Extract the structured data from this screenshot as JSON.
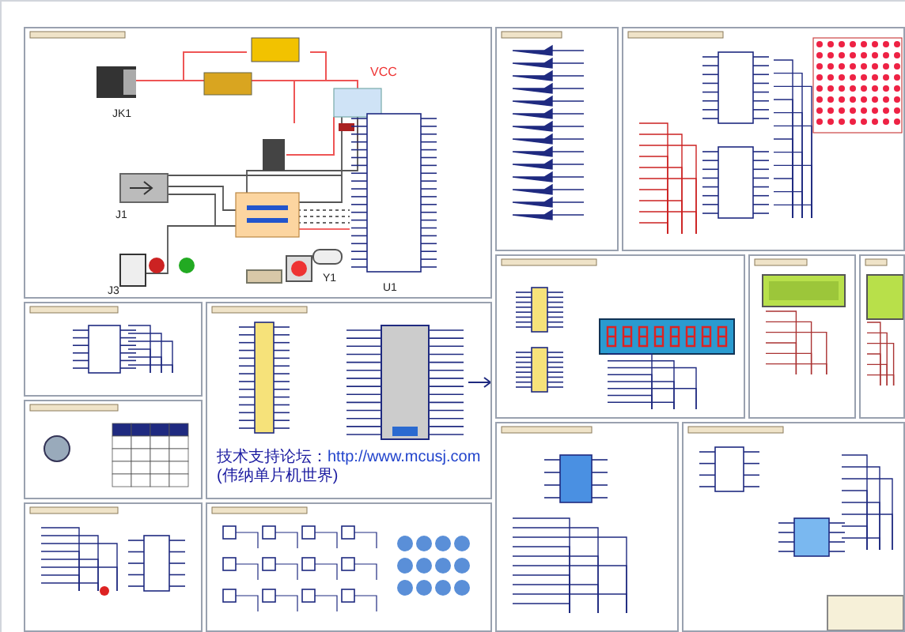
{
  "power_panel": {
    "labels": [
      {
        "kind": "ref",
        "text": "JK1"
      },
      {
        "kind": "ref",
        "text": "J1"
      },
      {
        "kind": "ref",
        "text": "J3"
      },
      {
        "kind": "ref",
        "text": "Y1"
      },
      {
        "kind": "ref",
        "text": "U1"
      },
      {
        "kind": "net",
        "text": "VCC"
      }
    ]
  },
  "forum_note": {
    "prefix": "技术支持论坛：",
    "link": "http://www.mcusj.com",
    "suffix": "(伟纳单片机世界)"
  }
}
